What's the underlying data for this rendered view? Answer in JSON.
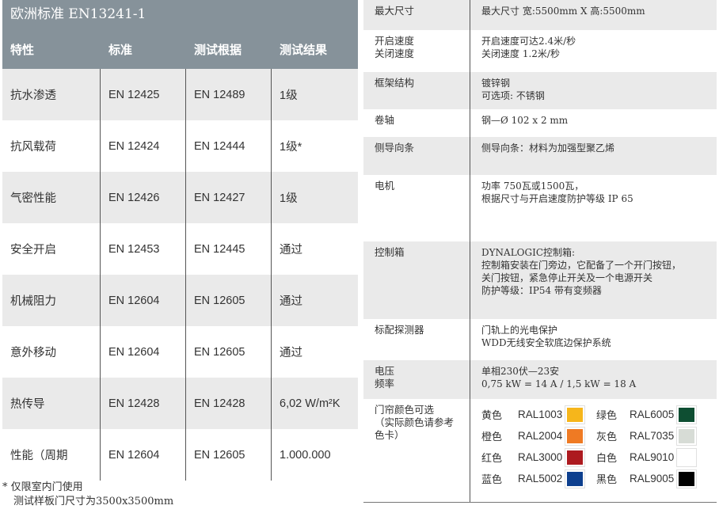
{
  "left_table": {
    "title": "欧洲标准 EN13241-1",
    "headers": [
      "特性",
      "标准",
      "测试根据",
      "测试结果"
    ],
    "rows": [
      [
        "抗水渗透",
        "EN 12425",
        "EN 12489",
        "1级"
      ],
      [
        "抗风载荷",
        "EN 12424",
        "EN 12444",
        "1级*"
      ],
      [
        "气密性能",
        "EN 12426",
        "EN 12427",
        "1级"
      ],
      [
        "安全开启",
        "EN 12453",
        "EN 12445",
        "通过"
      ],
      [
        "机械阻力",
        "EN 12604",
        "EN 12605",
        "通过"
      ],
      [
        "意外移动",
        "EN 12604",
        "EN 12605",
        "通过"
      ],
      [
        "热传导",
        "EN 12428",
        "EN 12428",
        "6,02 W/m²K"
      ],
      [
        "性能（周期",
        "EN 12604",
        "EN 12605",
        "1.000.000"
      ]
    ]
  },
  "footnote": {
    "line1": "* 仅限室内门使用",
    "line2": "测试样板门尺寸为3500x3500mm"
  },
  "spec_table": {
    "rows": [
      {
        "label": "最大尺寸",
        "value": "最大尺寸  宽:5500mm X 高:5500mm"
      },
      {
        "label": "开启速度\n关闭速度",
        "value": "开启速度可达2.4米/秒\n关闭速度 1.2米/秒"
      },
      {
        "label": "框架结构",
        "value": "镀锌钢\n可选项:  不锈钢"
      },
      {
        "label": "卷轴",
        "value": "钢—Ø 102 x 2 mm"
      },
      {
        "label": "侧导向条",
        "value": "侧导向条：材料为加强型聚乙烯"
      },
      {
        "label": "电机",
        "value": "功率 750瓦或1500瓦，\n根据尺寸与开启速度防护等级 IP 65"
      },
      {
        "label": "控制箱",
        "value": "DYNALOGIC控制箱:\n控制箱安装在门旁边，它配备了一个开门按钮，\n关门按钮，紧急停止开关及一个电源开关\n防护等级：IP54 带有变频器"
      },
      {
        "label": "标配探测器",
        "value": "门轨上的光电保护\nWDD无线安全软底边保护系统"
      },
      {
        "label": "电压\n频率",
        "value": "单相230伏—23安\n0,75 kW = 14 A / 1,5 kW = 18 A"
      },
      {
        "label": "门帘颜色可选\n（实际颜色请参考\n色卡）",
        "value": ""
      }
    ],
    "colors": [
      {
        "name": "黄色",
        "code": "RAL1003",
        "hex": "#f6b61b"
      },
      {
        "name": "绿色",
        "code": "RAL6005",
        "hex": "#0e4e32"
      },
      {
        "name": "橙色",
        "code": "RAL2004",
        "hex": "#ef7a23"
      },
      {
        "name": "灰色",
        "code": "RAL7035",
        "hex": "#d7dcd6"
      },
      {
        "name": "红色",
        "code": "RAL3000",
        "hex": "#ad1a1f"
      },
      {
        "name": "白色",
        "code": "RAL9010",
        "hex": "#ffffff"
      },
      {
        "name": "蓝色",
        "code": "RAL5002",
        "hex": "#0d3f8e"
      },
      {
        "name": "黑色",
        "code": "RAL9005",
        "hex": "#000000"
      }
    ]
  },
  "theme": {
    "header_bg": "#86929a",
    "row_alt_bg": "#eaeaea"
  }
}
